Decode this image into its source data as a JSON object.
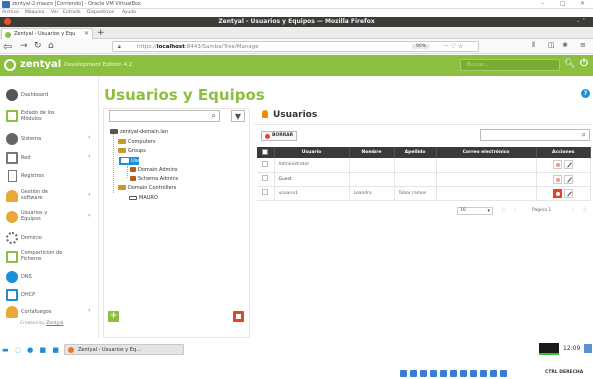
{
  "vbox": {
    "title": "zentyal-2-mauro [Corriendo] - Oracle VM VirtualBox",
    "menu": [
      "Archivo",
      "Máquina",
      "Ver",
      "Entrada",
      "Dispositivos",
      "Ayuda"
    ],
    "host_key": "CTRL DERECHA"
  },
  "firefox": {
    "window_title": "Zentyal - Usuarios y Equipos — Mozilla Firefox",
    "tab_label": "Zentyal - Usuarios y Equ",
    "url_prefix": "https://",
    "url_host": "localhost",
    "url_path": ":8443/Samba/Tree/Manage",
    "zoom": "90%"
  },
  "zentyal": {
    "brand": "zentyal",
    "edition": "Development Edition  4.2",
    "search_placeholder": "Buscar...",
    "accent": "#8bbf3f",
    "sidebar": [
      {
        "label": "Dashboard",
        "icon": "dashboard-icon",
        "arrow": false
      },
      {
        "label": "Estado de los Módulos",
        "icon": "modules-icon",
        "arrow": false
      },
      {
        "label": "Sistema",
        "icon": "gear-icon",
        "arrow": true
      },
      {
        "label": "Red",
        "icon": "network-icon",
        "arrow": true
      },
      {
        "label": "Registros",
        "icon": "logs-icon",
        "arrow": false
      },
      {
        "label": "Gestión de software",
        "icon": "software-icon",
        "arrow": true
      },
      {
        "label": "Usuarios y Equipos",
        "icon": "users-icon",
        "arrow": true
      },
      {
        "label": "Dominio",
        "icon": "domain-icon",
        "arrow": false
      },
      {
        "label": "Compartición de Ficheros",
        "icon": "share-icon",
        "arrow": false
      },
      {
        "label": "DNS",
        "icon": "dns-icon",
        "arrow": false
      },
      {
        "label": "DHCP",
        "icon": "dhcp-icon",
        "arrow": false
      },
      {
        "label": "Cortafuegos",
        "icon": "firewall-icon",
        "arrow": true
      }
    ],
    "created_by": "Created by",
    "created_link": "Zentyal",
    "page_title": "Usuarios y Equipos",
    "tree": {
      "root": "zentyal-domain.lan",
      "computers": "Computers",
      "groups": "Groups",
      "users": "Users",
      "domain_admins": "Domain Admins",
      "schema_admins": "Schema Admins",
      "domain_controllers": "Domain Controllers",
      "dc_host": "MAURO"
    },
    "panel": {
      "title": "Usuarios",
      "delete_label": "BORRAR",
      "columns": [
        "Usuario",
        "Nombre",
        "Apellido",
        "Correo electrónico",
        "Acciones"
      ],
      "rows": [
        {
          "user": "Administrator",
          "name": "",
          "surname": "",
          "email": "",
          "can_delete": false
        },
        {
          "user": "Guest",
          "name": "",
          "surname": "",
          "email": "",
          "can_delete": false
        },
        {
          "user": "usuario1",
          "name": "Leandro",
          "surname": "Tobar ramos",
          "email": "",
          "can_delete": true
        }
      ],
      "page_size": "10",
      "page_info": "Página 1"
    }
  },
  "taskbar": {
    "task_label": "Zentyal - Usuarios y Eq...",
    "clock": "12:09"
  }
}
